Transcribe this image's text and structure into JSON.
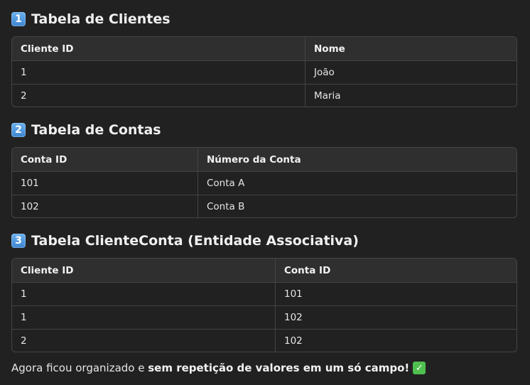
{
  "sections": [
    {
      "number": "1",
      "title": "Tabela de Clientes",
      "columns": [
        "Cliente ID",
        "Nome"
      ],
      "rows": [
        [
          "1",
          "João"
        ],
        [
          "2",
          "Maria"
        ]
      ]
    },
    {
      "number": "2",
      "title": "Tabela de Contas",
      "columns": [
        "Conta ID",
        "Número da Conta"
      ],
      "rows": [
        [
          "101",
          "Conta A"
        ],
        [
          "102",
          "Conta B"
        ]
      ]
    },
    {
      "number": "3",
      "title": "Tabela ClienteConta (Entidade Associativa)",
      "columns": [
        "Cliente ID",
        "Conta ID"
      ],
      "rows": [
        [
          "1",
          "101"
        ],
        [
          "1",
          "102"
        ],
        [
          "2",
          "102"
        ]
      ]
    }
  ],
  "footer": {
    "text_plain": "Agora ficou organizado e ",
    "text_bold": "sem repetição de valores em um só campo!",
    "icon": "check-mark-icon"
  },
  "colors": {
    "background": "#212121",
    "header_row": "#2f2f2f",
    "border": "#444444",
    "keycap_badge": "#4a90e2",
    "check_badge": "#4fbf4f"
  }
}
